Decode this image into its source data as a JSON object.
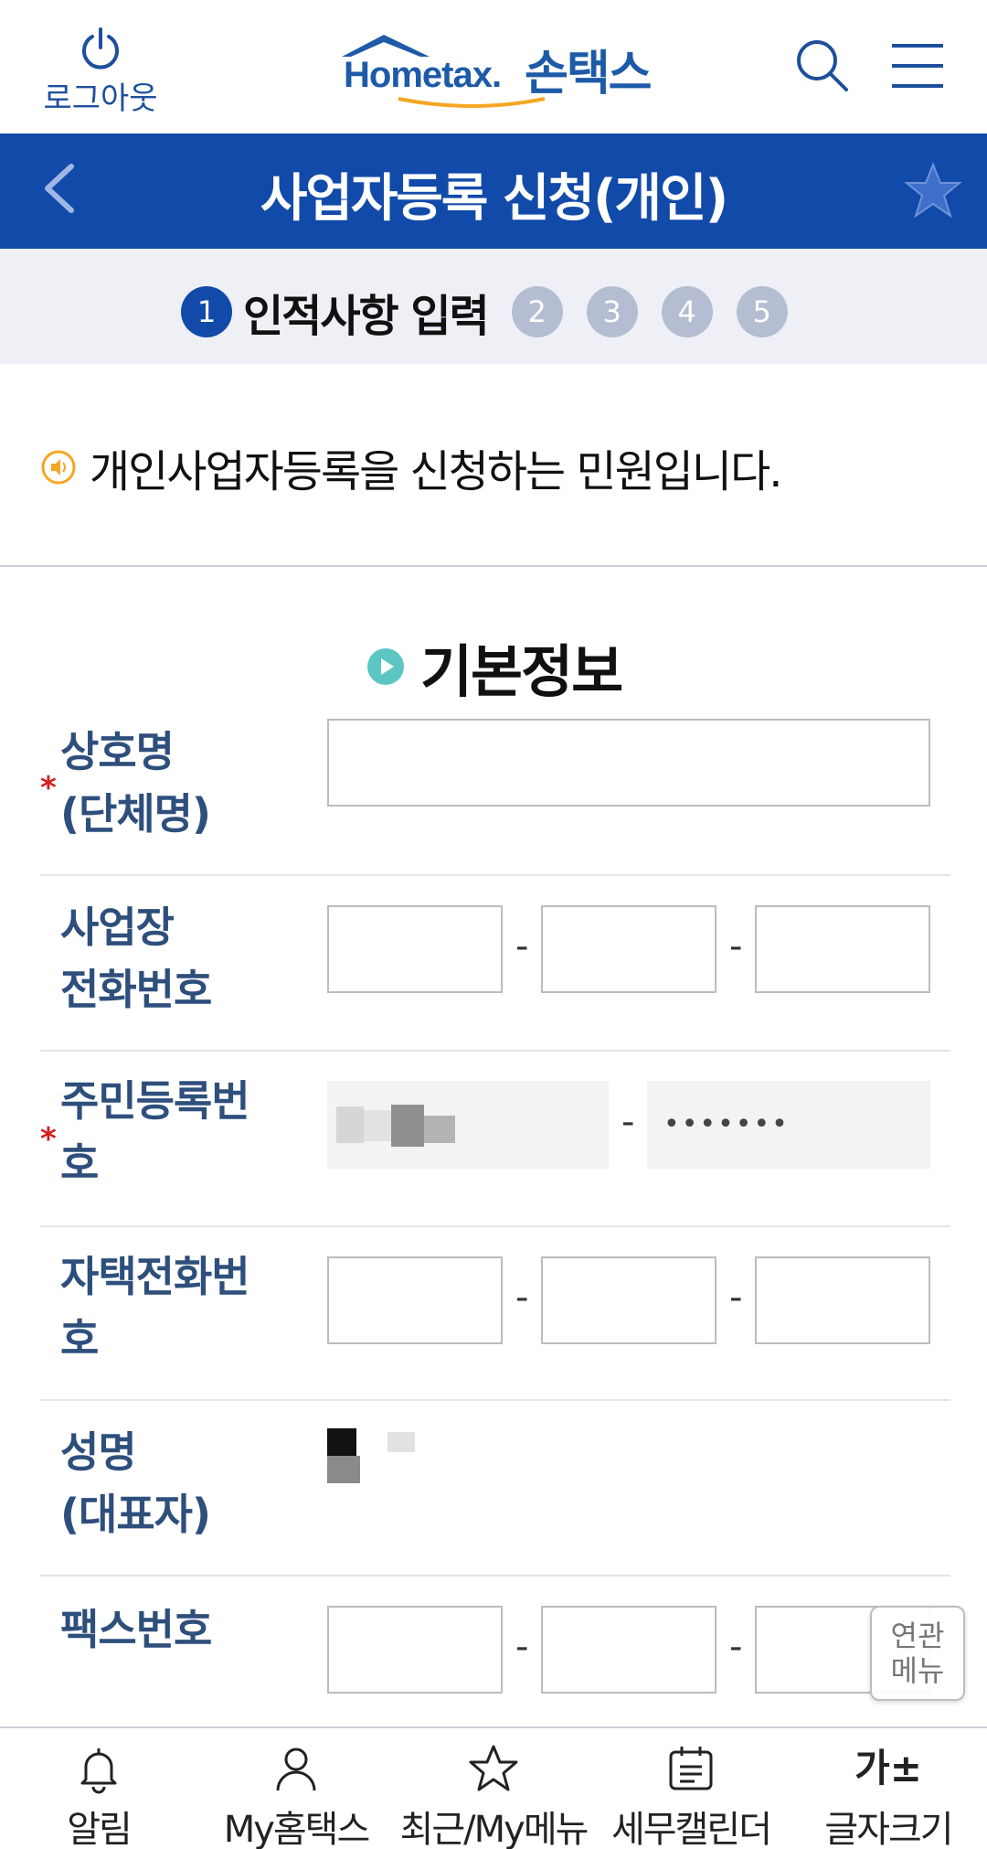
{
  "header": {
    "logout_label": "로그아웃",
    "brand_name": "Hometax.",
    "brand_sub": "손택스"
  },
  "title_bar": {
    "title": "사업자등록 신청(개인)"
  },
  "steps": {
    "active_number": "1",
    "active_label": "인적사항 입력",
    "others": [
      "2",
      "3",
      "4",
      "5"
    ]
  },
  "notice": {
    "text": "개인사업자등록을 신청하는 민원입니다."
  },
  "section": {
    "title": "기본정보"
  },
  "form": {
    "required_mark": "*",
    "dash": "-",
    "fields": [
      {
        "label_line1": "상호명",
        "label_line2": "(단체명)"
      },
      {
        "label_line1": "사업장",
        "label_line2": "전화번호"
      },
      {
        "label_line1": "주민등록번",
        "label_line2": "호",
        "masked_back": "•••••••"
      },
      {
        "label_line1": "자택전화번",
        "label_line2": "호"
      },
      {
        "label_line1": "성명",
        "label_line2": "(대표자)"
      },
      {
        "label_line1": "팩스번호",
        "label_line2": ""
      }
    ]
  },
  "related_menu": {
    "line1": "연관",
    "line2": "메뉴"
  },
  "bottom_nav": {
    "items": [
      {
        "label": "알림",
        "icon": "bell-icon"
      },
      {
        "label": "My홈택스",
        "icon": "user-icon"
      },
      {
        "label": "최근/My메뉴",
        "icon": "star-icon"
      },
      {
        "label": "세무캘린더",
        "icon": "calendar-icon"
      },
      {
        "label": "글자크기",
        "icon": "font-size-icon",
        "glyph": "가±"
      }
    ]
  },
  "colors": {
    "primary": "#114aa9",
    "label": "#2e4f7c",
    "required": "#d81e1e",
    "notice_icon": "#f5a623",
    "section_icon": "#5cc6c3"
  }
}
